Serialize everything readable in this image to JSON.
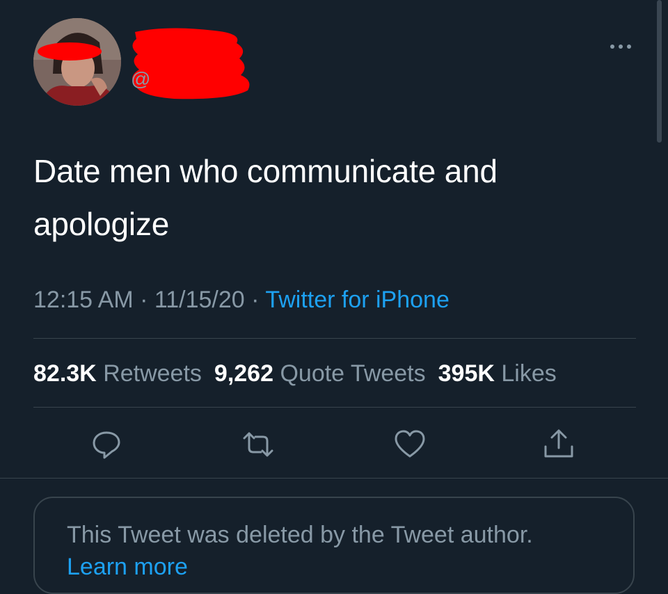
{
  "tweet": {
    "handle_prefix": "@",
    "text_line1": "Date men who communicate and",
    "text_line2": "apologize",
    "time": "12:15 AM",
    "date": "11/15/20",
    "separator": " · ",
    "source": "Twitter for iPhone"
  },
  "stats": {
    "retweets_count": "82.3K",
    "retweets_label": "Retweets",
    "quotes_count": "9,262",
    "quotes_label": "Quote Tweets",
    "likes_count": "395K",
    "likes_label": "Likes"
  },
  "actions": {
    "icons": [
      "reply-icon",
      "retweet-icon",
      "like-icon",
      "share-icon"
    ]
  },
  "deleted_quote": {
    "message": "This Tweet was deleted by the Tweet author.",
    "link": "Learn more"
  },
  "colors": {
    "background": "#15202b",
    "text_primary": "#ffffff",
    "text_secondary": "#8899a6",
    "accent": "#1da1f2",
    "border": "#38444d",
    "redaction": "#ff0000"
  }
}
